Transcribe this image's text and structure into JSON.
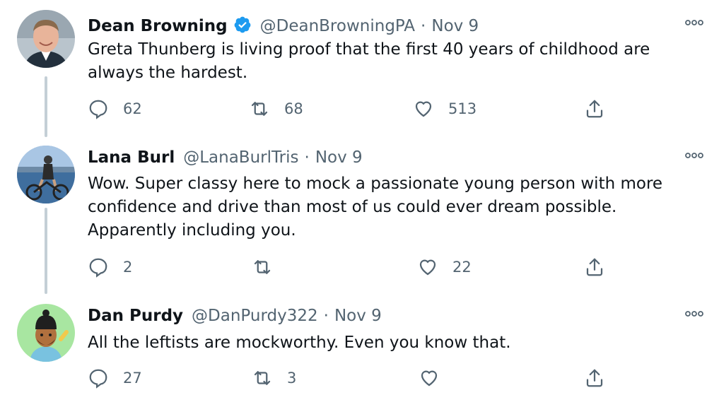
{
  "tweets": [
    {
      "name": "Dean Browning",
      "verified": true,
      "handle": "@DeanBrowningPA",
      "separator": "·",
      "date": "Nov 9",
      "text": "Greta Thunberg is living proof that the first 40 years of childhood are always the hardest.",
      "replies": "62",
      "retweets": "68",
      "likes": "513"
    },
    {
      "name": "Lana Burl",
      "verified": false,
      "handle": "@LanaBurlTris",
      "separator": "·",
      "date": "Nov 9",
      "text": "Wow. Super classy here to mock a passionate young person with more confidence and drive than most of us could ever dream possible. Apparently including you.",
      "replies": "2",
      "retweets": "",
      "likes": "22"
    },
    {
      "name": "Dan Purdy",
      "verified": false,
      "handle": "@DanPurdy322",
      "separator": "·",
      "date": "Nov 9",
      "text": "All the leftists are mockworthy. Even you know that.",
      "replies": "27",
      "retweets": "3",
      "likes": ""
    }
  ],
  "colors": {
    "text": "#0f1419",
    "secondary": "#536471",
    "verified_blue": "#1d9bf0",
    "thread_line": "#c4cfd6"
  },
  "icons": [
    "reply-icon",
    "retweet-icon",
    "like-icon",
    "share-icon",
    "more-icon",
    "verified-badge-icon"
  ]
}
